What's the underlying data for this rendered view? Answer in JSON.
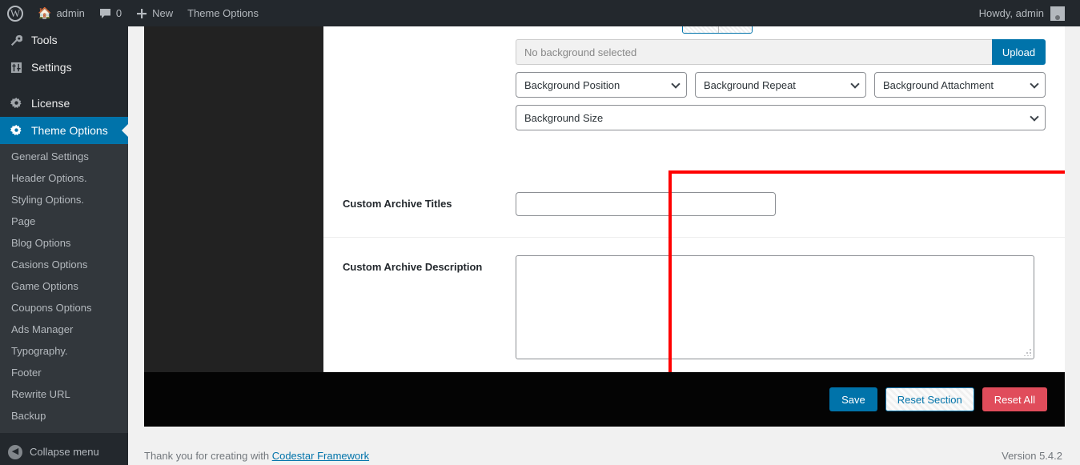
{
  "adminbar": {
    "logo_icon": "wordpress-logo-icon",
    "site_icon": "home-icon",
    "site_name": "admin",
    "comments_icon": "comment-bubble-icon",
    "comments_count": "0",
    "new_icon": "plus-icon",
    "new_label": "New",
    "theme_options_label": "Theme Options",
    "howdy": "Howdy, admin",
    "avatar_icon": "user-avatar-icon"
  },
  "sidebar": {
    "top_items": [
      {
        "label": "Tools",
        "icon": "wrench-icon",
        "active": false
      },
      {
        "label": "Settings",
        "icon": "sliders-icon",
        "active": false
      },
      {
        "label": "License",
        "icon": "gear-icon",
        "active": false
      },
      {
        "label": "Theme Options",
        "icon": "gear-icon",
        "active": true
      }
    ],
    "submenu": [
      "General Settings",
      "Header Options.",
      "Styling Options.",
      "Page",
      "Blog Options",
      "Casions Options",
      "Game Options",
      "Coupons Options",
      "Ads Manager",
      "Typography.",
      "Footer",
      "Rewrite URL",
      "Backup"
    ],
    "collapse_label": "Collapse menu",
    "collapse_icon": "chevron-left-circle-icon",
    "active_color": "#0073aa"
  },
  "content": {
    "background": {
      "media_placeholder": "No background selected",
      "upload_label": "Upload",
      "position_label": "Background Position",
      "repeat_label": "Background Repeat",
      "attachment_label": "Background Attachment",
      "size_label": "Background Size",
      "chevron_icon": "chevron-down-icon"
    },
    "archive_titles": {
      "label": "Custom Archive Titles",
      "value": ""
    },
    "archive_description": {
      "label": "Custom Archive Description",
      "value": "",
      "resize_icon": "resize-grip-icon"
    },
    "highlight_color": "#ff0000"
  },
  "actions": {
    "save_label": "Save",
    "reset_section_label": "Reset Section",
    "reset_all_label": "Reset All",
    "save_color": "#0073aa",
    "reset_all_color": "#e04c5b"
  },
  "footer": {
    "thanks_prefix": "Thank you for creating with ",
    "framework_link": "Codestar Framework",
    "version": "Version 5.4.2"
  }
}
